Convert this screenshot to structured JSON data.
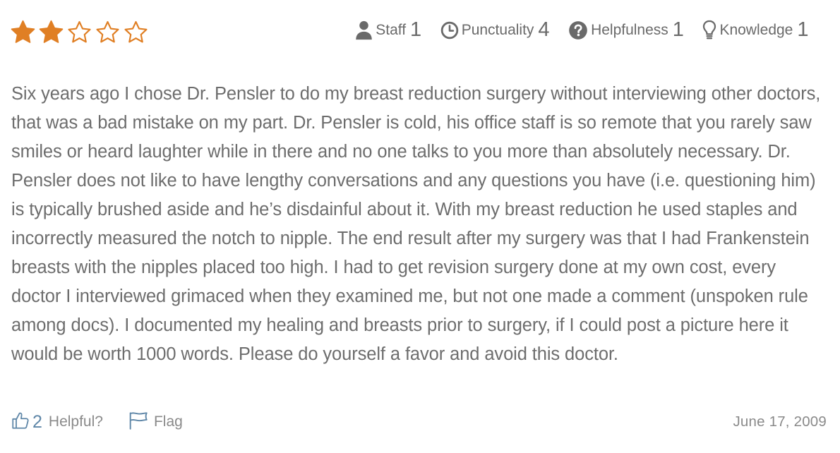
{
  "review": {
    "overall_rating": 2,
    "overall_max": 5,
    "star_color": "#e07f24",
    "categories": [
      {
        "label": "Staff",
        "value": "1",
        "icon": "person-icon"
      },
      {
        "label": "Punctuality",
        "value": "4",
        "icon": "clock-icon"
      },
      {
        "label": "Helpfulness",
        "value": "1",
        "icon": "question-circle-icon"
      },
      {
        "label": "Knowledge",
        "value": "1",
        "icon": "lightbulb-icon"
      }
    ],
    "text": "Six years ago I chose Dr. Pensler to do my breast reduction surgery without interviewing other doctors, that was a bad mistake on my part. Dr. Pensler is cold, his office staff is so remote that you rarely saw smiles or heard laughter while in there and no one talks to you more than absolutely necessary. Dr. Pensler does not like to have lengthy conversations and any questions you have (i.e. questioning him) is typically brushed aside and he’s disdainful about it. With my breast reduction he used staples and incorrectly measured the notch to nipple. The end result after my surgery was that I had Frankenstein breasts with the nipples placed too high. I had to get revision surgery done at my own cost, every doctor I interviewed grimaced when they examined me, but not one made a comment (unspoken rule among docs). I documented my healing and breasts prior to surgery, if I could post a picture here it would be worth 1000 words. Please do yourself a favor and avoid this doctor.",
    "footer": {
      "helpful_count": "2",
      "helpful_label": "Helpful?",
      "flag_label": "Flag",
      "date": "June 17, 2009"
    },
    "colors": {
      "accent_blue": "#5f87a8",
      "text_gray": "#6d6d6d"
    }
  }
}
